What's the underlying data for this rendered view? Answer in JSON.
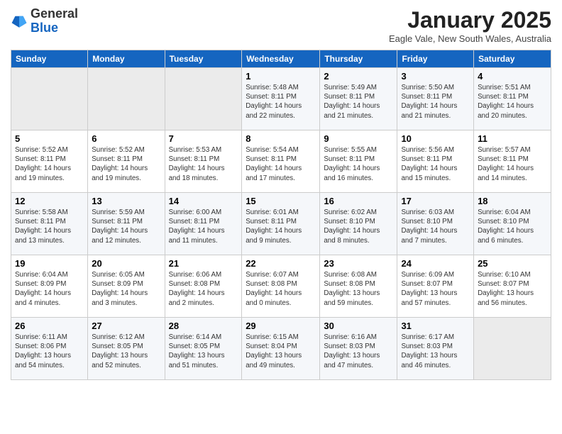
{
  "header": {
    "logo_line1": "General",
    "logo_line2": "Blue",
    "title": "January 2025",
    "subtitle": "Eagle Vale, New South Wales, Australia"
  },
  "days_of_week": [
    "Sunday",
    "Monday",
    "Tuesday",
    "Wednesday",
    "Thursday",
    "Friday",
    "Saturday"
  ],
  "weeks": [
    [
      {
        "day": "",
        "info": ""
      },
      {
        "day": "",
        "info": ""
      },
      {
        "day": "",
        "info": ""
      },
      {
        "day": "1",
        "info": "Sunrise: 5:48 AM\nSunset: 8:11 PM\nDaylight: 14 hours\nand 22 minutes."
      },
      {
        "day": "2",
        "info": "Sunrise: 5:49 AM\nSunset: 8:11 PM\nDaylight: 14 hours\nand 21 minutes."
      },
      {
        "day": "3",
        "info": "Sunrise: 5:50 AM\nSunset: 8:11 PM\nDaylight: 14 hours\nand 21 minutes."
      },
      {
        "day": "4",
        "info": "Sunrise: 5:51 AM\nSunset: 8:11 PM\nDaylight: 14 hours\nand 20 minutes."
      }
    ],
    [
      {
        "day": "5",
        "info": "Sunrise: 5:52 AM\nSunset: 8:11 PM\nDaylight: 14 hours\nand 19 minutes."
      },
      {
        "day": "6",
        "info": "Sunrise: 5:52 AM\nSunset: 8:11 PM\nDaylight: 14 hours\nand 19 minutes."
      },
      {
        "day": "7",
        "info": "Sunrise: 5:53 AM\nSunset: 8:11 PM\nDaylight: 14 hours\nand 18 minutes."
      },
      {
        "day": "8",
        "info": "Sunrise: 5:54 AM\nSunset: 8:11 PM\nDaylight: 14 hours\nand 17 minutes."
      },
      {
        "day": "9",
        "info": "Sunrise: 5:55 AM\nSunset: 8:11 PM\nDaylight: 14 hours\nand 16 minutes."
      },
      {
        "day": "10",
        "info": "Sunrise: 5:56 AM\nSunset: 8:11 PM\nDaylight: 14 hours\nand 15 minutes."
      },
      {
        "day": "11",
        "info": "Sunrise: 5:57 AM\nSunset: 8:11 PM\nDaylight: 14 hours\nand 14 minutes."
      }
    ],
    [
      {
        "day": "12",
        "info": "Sunrise: 5:58 AM\nSunset: 8:11 PM\nDaylight: 14 hours\nand 13 minutes."
      },
      {
        "day": "13",
        "info": "Sunrise: 5:59 AM\nSunset: 8:11 PM\nDaylight: 14 hours\nand 12 minutes."
      },
      {
        "day": "14",
        "info": "Sunrise: 6:00 AM\nSunset: 8:11 PM\nDaylight: 14 hours\nand 11 minutes."
      },
      {
        "day": "15",
        "info": "Sunrise: 6:01 AM\nSunset: 8:11 PM\nDaylight: 14 hours\nand 9 minutes."
      },
      {
        "day": "16",
        "info": "Sunrise: 6:02 AM\nSunset: 8:10 PM\nDaylight: 14 hours\nand 8 minutes."
      },
      {
        "day": "17",
        "info": "Sunrise: 6:03 AM\nSunset: 8:10 PM\nDaylight: 14 hours\nand 7 minutes."
      },
      {
        "day": "18",
        "info": "Sunrise: 6:04 AM\nSunset: 8:10 PM\nDaylight: 14 hours\nand 6 minutes."
      }
    ],
    [
      {
        "day": "19",
        "info": "Sunrise: 6:04 AM\nSunset: 8:09 PM\nDaylight: 14 hours\nand 4 minutes."
      },
      {
        "day": "20",
        "info": "Sunrise: 6:05 AM\nSunset: 8:09 PM\nDaylight: 14 hours\nand 3 minutes."
      },
      {
        "day": "21",
        "info": "Sunrise: 6:06 AM\nSunset: 8:08 PM\nDaylight: 14 hours\nand 2 minutes."
      },
      {
        "day": "22",
        "info": "Sunrise: 6:07 AM\nSunset: 8:08 PM\nDaylight: 14 hours\nand 0 minutes."
      },
      {
        "day": "23",
        "info": "Sunrise: 6:08 AM\nSunset: 8:08 PM\nDaylight: 13 hours\nand 59 minutes."
      },
      {
        "day": "24",
        "info": "Sunrise: 6:09 AM\nSunset: 8:07 PM\nDaylight: 13 hours\nand 57 minutes."
      },
      {
        "day": "25",
        "info": "Sunrise: 6:10 AM\nSunset: 8:07 PM\nDaylight: 13 hours\nand 56 minutes."
      }
    ],
    [
      {
        "day": "26",
        "info": "Sunrise: 6:11 AM\nSunset: 8:06 PM\nDaylight: 13 hours\nand 54 minutes."
      },
      {
        "day": "27",
        "info": "Sunrise: 6:12 AM\nSunset: 8:05 PM\nDaylight: 13 hours\nand 52 minutes."
      },
      {
        "day": "28",
        "info": "Sunrise: 6:14 AM\nSunset: 8:05 PM\nDaylight: 13 hours\nand 51 minutes."
      },
      {
        "day": "29",
        "info": "Sunrise: 6:15 AM\nSunset: 8:04 PM\nDaylight: 13 hours\nand 49 minutes."
      },
      {
        "day": "30",
        "info": "Sunrise: 6:16 AM\nSunset: 8:03 PM\nDaylight: 13 hours\nand 47 minutes."
      },
      {
        "day": "31",
        "info": "Sunrise: 6:17 AM\nSunset: 8:03 PM\nDaylight: 13 hours\nand 46 minutes."
      },
      {
        "day": "",
        "info": ""
      }
    ]
  ]
}
